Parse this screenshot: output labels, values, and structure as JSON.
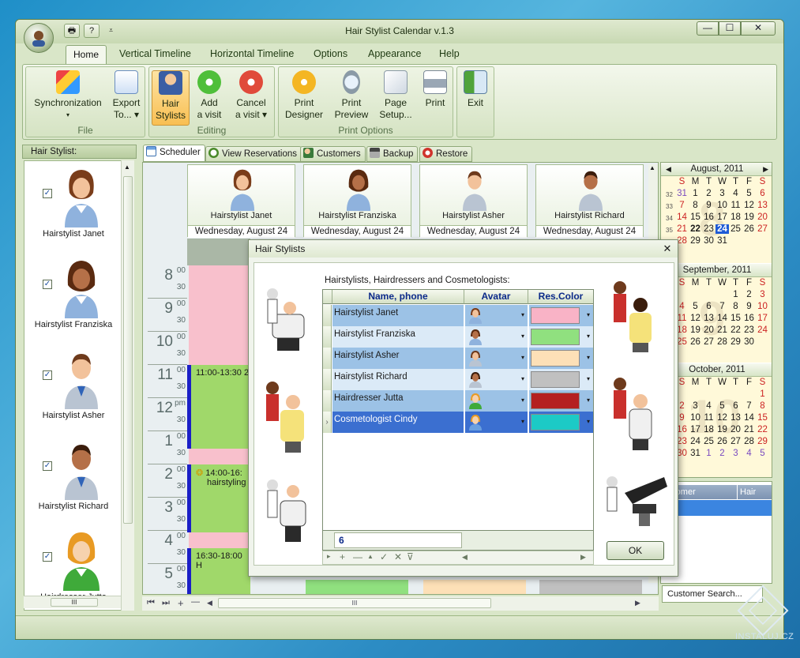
{
  "window": {
    "title": "Hair Stylist Calendar v.1.3",
    "minimize": "—",
    "maximize": "☐",
    "close": "✕"
  },
  "quick_access": [
    "print-icon",
    "help-icon",
    "customize-icon"
  ],
  "quick_access_help": "?",
  "quick_access_more": "⩡",
  "ribbon_tabs": [
    "Home",
    "Vertical Timeline",
    "Horizontal Timeline",
    "Options",
    "Appearance",
    "Help"
  ],
  "ribbon": {
    "groups": {
      "file": "File",
      "editing": "Editing",
      "print_options": "Print Options"
    },
    "buttons": {
      "synchronization": [
        "Synchronization",
        "▾"
      ],
      "export": [
        "Export",
        "To... ▾"
      ],
      "hair_stylists": [
        "Hair",
        "Stylists"
      ],
      "add_visit": [
        "Add",
        "a visit"
      ],
      "cancel_visit": [
        "Cancel",
        "a visit ▾"
      ],
      "print_designer": [
        "Print",
        "Designer"
      ],
      "print_preview": [
        "Print",
        "Preview"
      ],
      "page_setup": [
        "Page",
        "Setup..."
      ],
      "print": "Print",
      "exit": "Exit"
    }
  },
  "left_panel": {
    "header": "Hair Stylist:",
    "check_mark": "✓",
    "stylists": [
      "Hairstylist Janet",
      "Hairstylist Franziska",
      "Hairstylist Asher",
      "Hairstylist Richard",
      "Hairdresser Jutta"
    ],
    "hscroll_grip": "III"
  },
  "scheduler_tabs": [
    "Scheduler",
    "View Reservations",
    "Customers",
    "Backup",
    "Restore"
  ],
  "scheduler": {
    "resources": [
      {
        "name": "Hairstylist Janet",
        "date": "Wednesday, August 24"
      },
      {
        "name": "Hairstylist Franziska",
        "date": "Wednesday, August 24"
      },
      {
        "name": "Hairstylist Asher",
        "date": "Wednesday, August 24"
      },
      {
        "name": "Hairstylist Richard",
        "date": "Wednesday, August 24"
      }
    ],
    "hours": [
      {
        "h": "8",
        "m": "00",
        "m2": "30"
      },
      {
        "h": "9",
        "m": "00",
        "m2": "30"
      },
      {
        "h": "10",
        "m": "00",
        "m2": "30"
      },
      {
        "h": "11",
        "m": "00",
        "m2": "30"
      },
      {
        "h": "12",
        "m": "pm",
        "m2": "30"
      },
      {
        "h": "1",
        "m": "00",
        "m2": "30"
      },
      {
        "h": "2",
        "m": "00",
        "m2": "30"
      },
      {
        "h": "3",
        "m": "00",
        "m2": "30"
      },
      {
        "h": "4",
        "m": "00",
        "m2": "30"
      },
      {
        "h": "5",
        "m": "00",
        "m2": "30"
      }
    ],
    "appointments": [
      {
        "time": "11:00-13:30 2",
        "detail": ""
      },
      {
        "time": "14:00-16:",
        "detail": "hairstyling"
      },
      {
        "time": "16:30-18:00 H",
        "detail": ""
      }
    ],
    "nav_buttons": [
      "⏮",
      "⏭",
      "+",
      "—",
      "◀",
      "▶"
    ],
    "hscroll_grip": "III"
  },
  "calendar": {
    "months": [
      {
        "title": "August, 2011",
        "prev": "◀",
        "next": "▶",
        "watermark": "8"
      },
      {
        "title": "September, 2011",
        "watermark": "9"
      },
      {
        "title": "October, 2011",
        "watermark": "10"
      }
    ],
    "weekdays": [
      "S",
      "M",
      "T",
      "W",
      "T",
      "F",
      "S"
    ],
    "august_weeks": [
      {
        "wk": "32",
        "days": [
          "31",
          "1",
          "2",
          "3",
          "4",
          "5",
          "6"
        ]
      },
      {
        "wk": "33",
        "days": [
          "7",
          "8",
          "9",
          "10",
          "11",
          "12",
          "13"
        ]
      },
      {
        "wk": "34",
        "days": [
          "14",
          "15",
          "16",
          "17",
          "18",
          "19",
          "20"
        ]
      },
      {
        "wk": "35",
        "days": [
          "21",
          "22",
          "23",
          "24",
          "25",
          "26",
          "27"
        ]
      },
      {
        "wk": "36",
        "days": [
          "28",
          "29",
          "30",
          "31",
          "",
          ""
        ]
      }
    ],
    "september_rows": [
      [
        "",
        "",
        "",
        "",
        "1",
        "2",
        "3"
      ],
      [
        "4",
        "5",
        "6",
        "7",
        "8",
        "9",
        "10"
      ],
      [
        "11",
        "12",
        "13",
        "14",
        "15",
        "16",
        "17"
      ],
      [
        "18",
        "19",
        "20",
        "21",
        "22",
        "23",
        "24"
      ],
      [
        "25",
        "26",
        "27",
        "28",
        "29",
        "30",
        ""
      ]
    ],
    "october_rows": [
      [
        "",
        "",
        "",
        "",
        "",
        "",
        "1"
      ],
      [
        "2",
        "3",
        "4",
        "5",
        "6",
        "7",
        "8"
      ],
      [
        "9",
        "10",
        "11",
        "12",
        "13",
        "14",
        "15"
      ],
      [
        "16",
        "17",
        "18",
        "19",
        "20",
        "21",
        "22"
      ],
      [
        "23",
        "24",
        "25",
        "26",
        "27",
        "28",
        "29"
      ],
      [
        "30",
        "31",
        "1",
        "2",
        "3",
        "4",
        "5"
      ]
    ],
    "today": "24"
  },
  "customer_grid": {
    "headers": [
      "ustomer",
      "Hair Styl"
    ]
  },
  "customer_search": "Customer Search...",
  "dialog": {
    "title": "Hair Stylists",
    "close": "✕",
    "grid_label": "Hairstylists, Hairdressers and Cosmetologists:",
    "columns": [
      "Name, phone",
      "Avatar",
      "Res.Color"
    ],
    "dropdown": "▾",
    "selected_indicator": "›",
    "rows": [
      {
        "name": "Hairstylist Janet",
        "color": "#f9b3c6"
      },
      {
        "name": "Hairstylist Franziska",
        "color": "#90e07f"
      },
      {
        "name": "Hairstylist Asher",
        "color": "#fde0b7"
      },
      {
        "name": "Hairstylist Richard",
        "color": "#c0c0c0"
      },
      {
        "name": "Hairdresser Jutta",
        "color": "#b42020"
      },
      {
        "name": "Cosmetologist Cindy",
        "color": "#1ccac6"
      }
    ],
    "count": "6",
    "navigator": [
      "▸",
      "+",
      "—",
      "▲",
      "✓",
      "✕",
      "⊽",
      "◀",
      "▶"
    ],
    "ok": "OK"
  },
  "watermark_text": "INSTALUJ.CZ",
  "colors": {
    "accent": "#1b1fc7",
    "appt_green": "#a0d86a",
    "appt_pink": "#f8c0cc",
    "selected_row": "#3b6fd0",
    "row_blue": "#9cc2e6",
    "row_lightblue": "#dbeaf7"
  }
}
